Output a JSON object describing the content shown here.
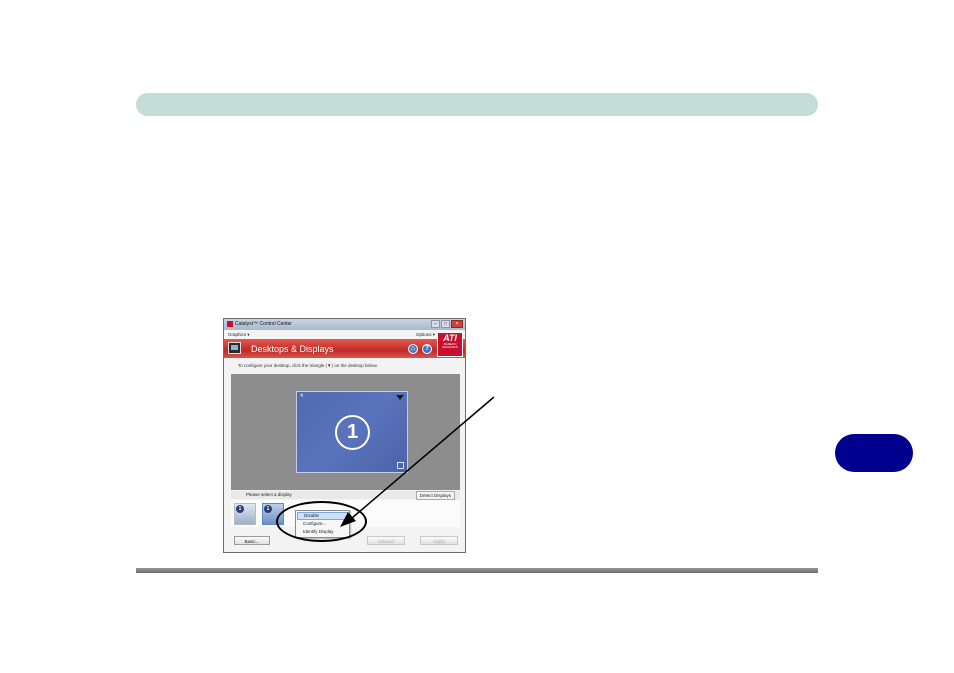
{
  "window": {
    "title": "Catalyst™ Control Center",
    "menu_left": "Graphics ▾",
    "menu_right": "Options ▾",
    "page_title": "Desktops & Displays",
    "brand": "ATI",
    "brand_sub": "RADEON GRAPHICS",
    "instruction": "To configure your desktop, click the triangle (▼) on the desktop below.",
    "desktop_number": "1",
    "select_display_label": "Please select a display",
    "detect_button": "Detect Displays",
    "thumb_badges": [
      "1",
      "1"
    ],
    "context_menu": [
      "Disable",
      "Configure...",
      "Identify Display"
    ],
    "bottom_buttons": [
      "Basic...",
      "Discard",
      "Apply"
    ]
  },
  "icons": [
    "ati-app-icon",
    "minimize-icon",
    "maximize-icon",
    "close-icon",
    "display-icon",
    "home-icon",
    "help-icon",
    "star-icon",
    "triangle-dropdown-icon",
    "copy-icon",
    "laptop-display-icon",
    "monitor-display-icon"
  ]
}
